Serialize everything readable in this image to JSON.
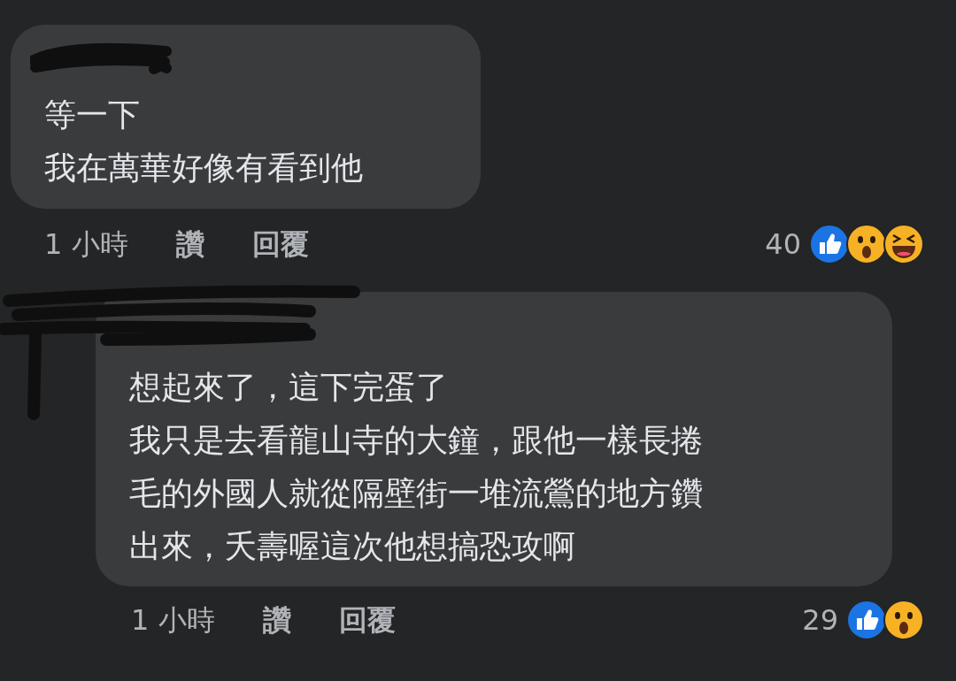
{
  "comments": [
    {
      "lines": [
        "等一下",
        "我在萬華好像有看到他"
      ],
      "time": "1 小時",
      "actions": [
        "讚",
        "回覆"
      ],
      "reaction_count": "40",
      "reactions": [
        {
          "kind": "like"
        },
        {
          "kind": "wow"
        },
        {
          "kind": "haha"
        }
      ],
      "replies": [
        {
          "lines": [
            "想起來了，這下完蛋了",
            "我只是去看龍山寺的大鐘，跟他一樣長捲",
            "毛的外國人就從隔壁街一堆流鶯的地方鑽",
            "出來，夭壽喔這次他想搞恐攻啊"
          ],
          "time": "1 小時",
          "actions": [
            "讚",
            "回覆"
          ],
          "reaction_count": "29",
          "reactions": [
            {
              "kind": "like"
            },
            {
              "kind": "wow"
            }
          ]
        }
      ]
    }
  ]
}
